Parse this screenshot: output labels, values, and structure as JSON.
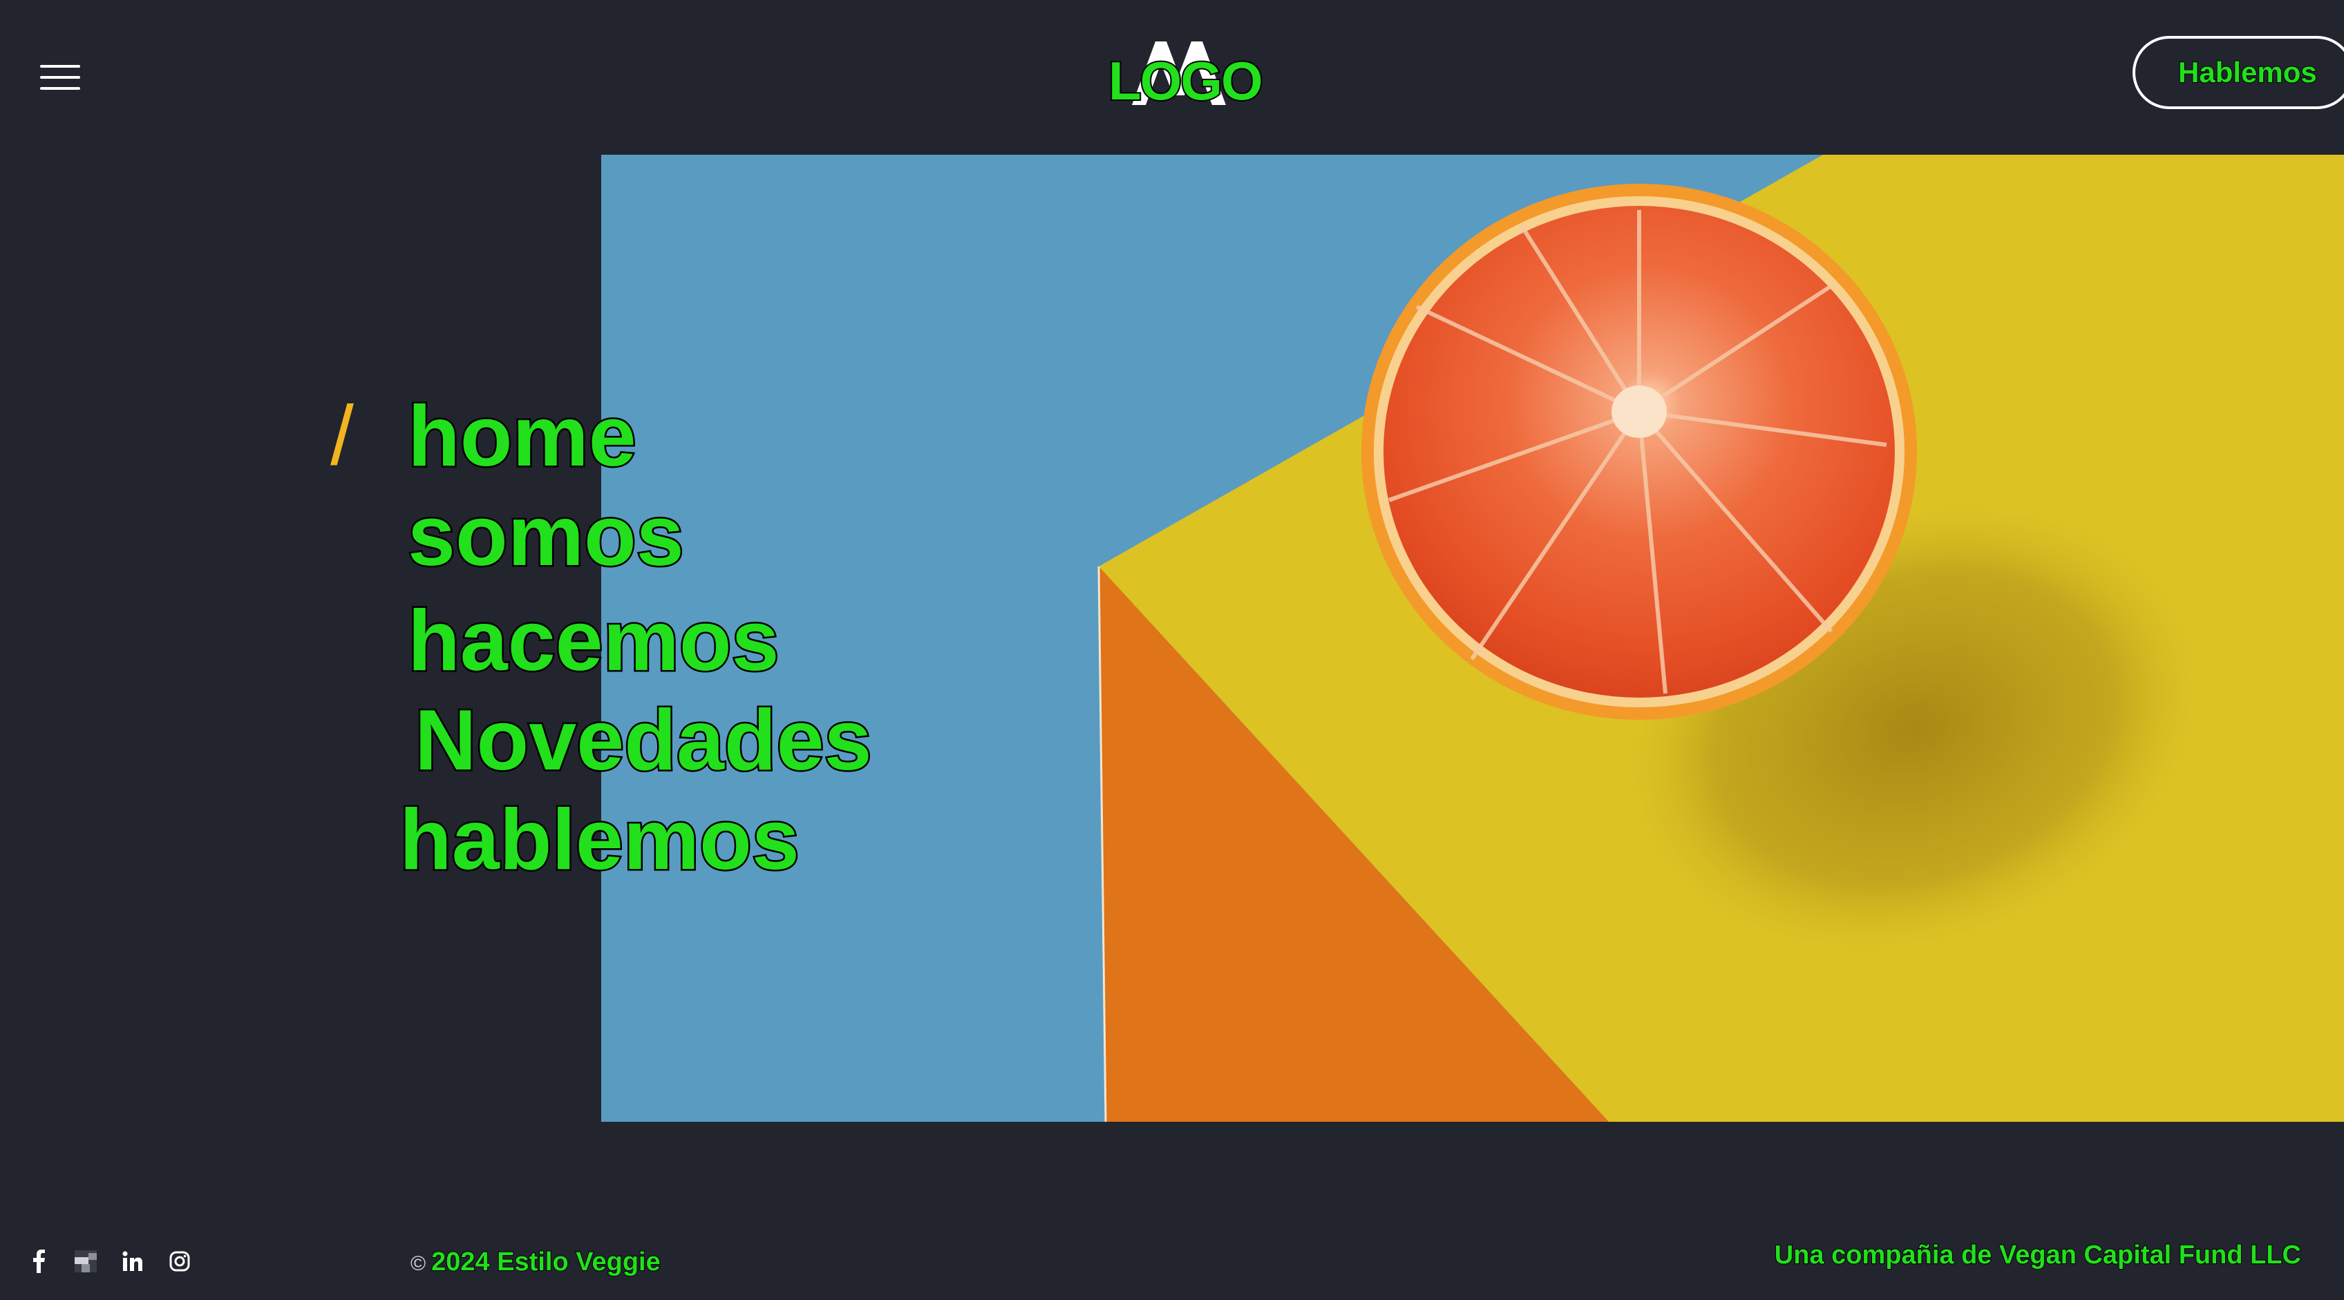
{
  "header": {
    "logo_text": "LOGO",
    "cta_label": "Hablemos"
  },
  "nav": {
    "slash": "/",
    "items": [
      {
        "label": "home"
      },
      {
        "label": "somos"
      },
      {
        "label": "hacemos"
      },
      {
        "label": "Novedades"
      },
      {
        "label": "hablemos"
      }
    ]
  },
  "footer": {
    "copyright_symbol": "©",
    "copyright_text": "2024 Estilo Veggie",
    "company": "Una compañia de Vegan Capital Fund LLC",
    "socials": [
      "facebook-icon",
      "pixel-icon",
      "linkedin-icon",
      "instagram-icon"
    ]
  },
  "colors": {
    "background": "#22252e",
    "accent_slash": "#f3b51f",
    "label_green": "#22e01c",
    "hero_blue": "#5a9bc2",
    "hero_yellow": "#dcc223",
    "hero_orange": "#e07418"
  }
}
